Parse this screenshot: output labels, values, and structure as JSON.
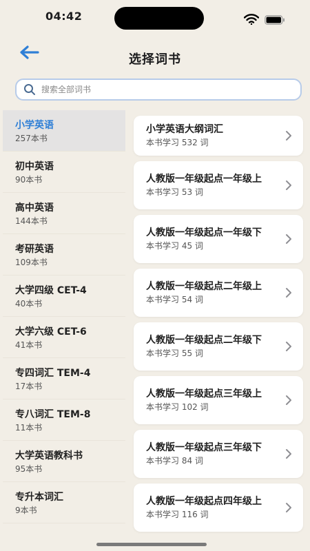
{
  "status": {
    "time": "04:42"
  },
  "header": {
    "title": "选择词书"
  },
  "search": {
    "placeholder": "搜索全部词书"
  },
  "categories": [
    {
      "name": "小学英语",
      "count": "257本书"
    },
    {
      "name": "初中英语",
      "count": "90本书"
    },
    {
      "name": "高中英语",
      "count": "144本书"
    },
    {
      "name": "考研英语",
      "count": "109本书"
    },
    {
      "name": "大学四级 CET-4",
      "count": "40本书"
    },
    {
      "name": "大学六级 CET-6",
      "count": "41本书"
    },
    {
      "name": "专四词汇 TEM-4",
      "count": "17本书"
    },
    {
      "name": "专八词汇 TEM-8",
      "count": "11本书"
    },
    {
      "name": "大学英语教科书",
      "count": "95本书"
    },
    {
      "name": "专升本词汇",
      "count": "9本书"
    }
  ],
  "books": [
    {
      "title": "小学英语大纲词汇",
      "meta": "本书学习 532 词"
    },
    {
      "title": "人教版一年级起点一年级上",
      "meta": "本书学习 53 词"
    },
    {
      "title": "人教版一年级起点一年级下",
      "meta": "本书学习 45 词"
    },
    {
      "title": "人教版一年级起点二年级上",
      "meta": "本书学习 54 词"
    },
    {
      "title": "人教版一年级起点二年级下",
      "meta": "本书学习 55 词"
    },
    {
      "title": "人教版一年级起点三年级上",
      "meta": "本书学习 102 词"
    },
    {
      "title": "人教版一年级起点三年级下",
      "meta": "本书学习 84 词"
    },
    {
      "title": "人教版一年级起点四年级上",
      "meta": "本书学习 116 词"
    }
  ],
  "colors": {
    "accent": "#2f7fd6",
    "background": "#f2eee6",
    "active_item": "#e4e3e3"
  },
  "icons": [
    "back-arrow-icon",
    "search-icon",
    "chevron-right-icon",
    "wifi-icon",
    "battery-icon"
  ]
}
